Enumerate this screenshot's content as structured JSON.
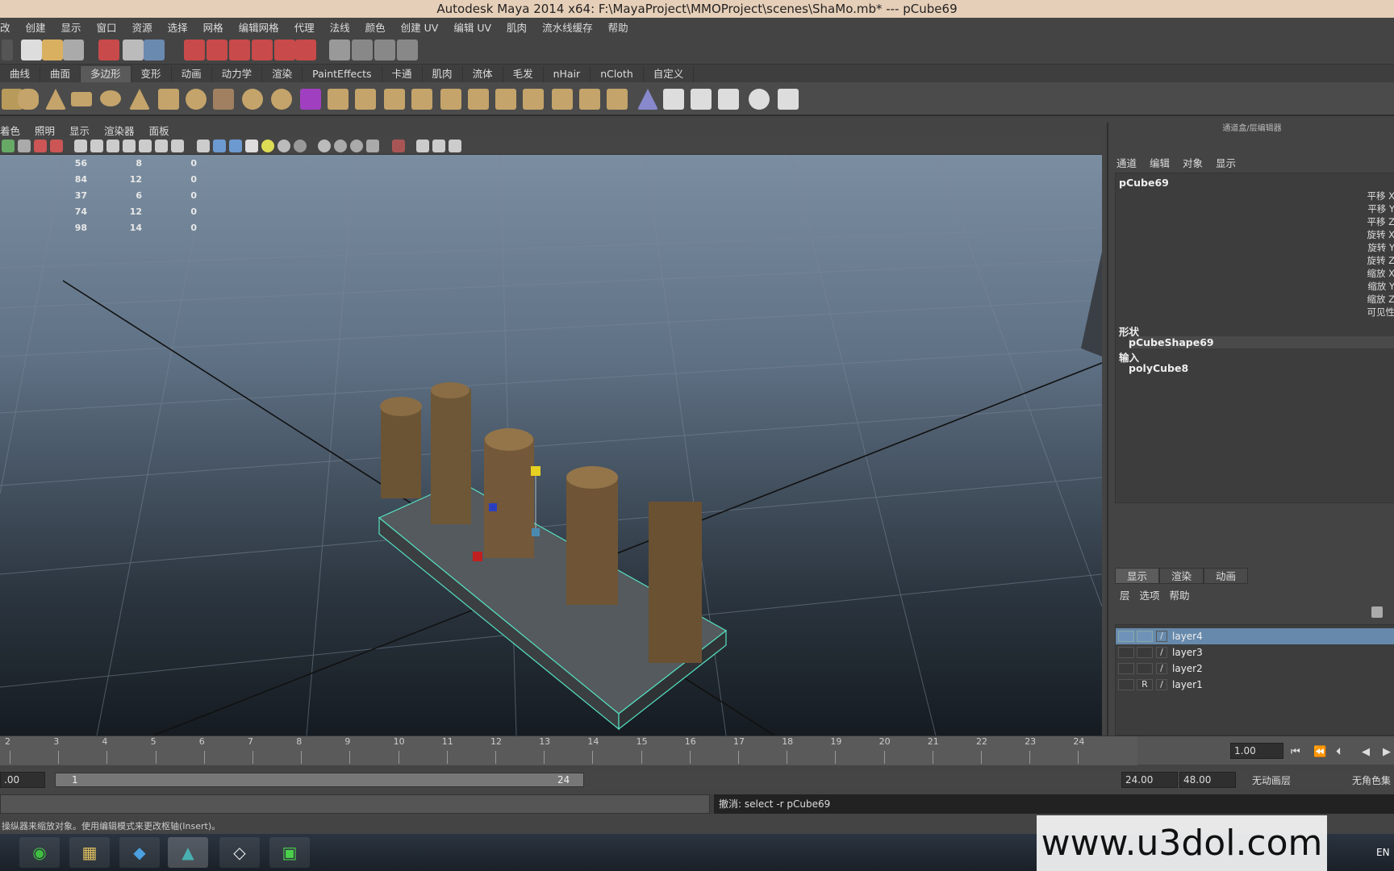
{
  "window": {
    "title": "Autodesk Maya 2014 x64: F:\\MayaProject\\MMOProject\\scenes\\ShaMo.mb*   ---   pCube69"
  },
  "menubar": [
    "改",
    "创建",
    "显示",
    "窗口",
    "资源",
    "选择",
    "网格",
    "编辑网格",
    "代理",
    "法线",
    "颜色",
    "创建 UV",
    "编辑 UV",
    "肌肉",
    "流水线缓存",
    "帮助"
  ],
  "shelf_tabs": [
    {
      "label": "曲线",
      "active": false
    },
    {
      "label": "曲面",
      "active": false
    },
    {
      "label": "多边形",
      "active": true
    },
    {
      "label": "变形",
      "active": false
    },
    {
      "label": "动画",
      "active": false
    },
    {
      "label": "动力学",
      "active": false
    },
    {
      "label": "渲染",
      "active": false
    },
    {
      "label": "PaintEffects",
      "active": false
    },
    {
      "label": "卡通",
      "active": false
    },
    {
      "label": "肌肉",
      "active": false
    },
    {
      "label": "流体",
      "active": false
    },
    {
      "label": "毛发",
      "active": false
    },
    {
      "label": "nHair",
      "active": false
    },
    {
      "label": "nCloth",
      "active": false
    },
    {
      "label": "自定义",
      "active": false
    }
  ],
  "panel_menu": [
    "着色",
    "照明",
    "显示",
    "渲染器",
    "面板"
  ],
  "hud": [
    [
      "56",
      "8",
      "0"
    ],
    [
      "84",
      "12",
      "0"
    ],
    [
      "37",
      "6",
      "0"
    ],
    [
      "74",
      "12",
      "0"
    ],
    [
      "98",
      "14",
      "0"
    ]
  ],
  "channel_box": {
    "title": "通道盒/层编辑器",
    "menu": [
      "通道",
      "编辑",
      "对象",
      "显示"
    ],
    "object": "pCube69",
    "attributes": [
      "平移 X",
      "平移 Y",
      "平移 Z",
      "旋转 X",
      "旋转 Y",
      "旋转 Z",
      "缩放 X",
      "缩放 Y",
      "缩放 Z",
      "可见性"
    ],
    "shapes_label": "形状",
    "shape": "pCubeShape69",
    "inputs_label": "输入",
    "input": "polyCube8"
  },
  "layer_editor": {
    "tabs": [
      {
        "label": "显示",
        "active": true
      },
      {
        "label": "渲染",
        "active": false
      },
      {
        "label": "动画",
        "active": false
      }
    ],
    "menu": [
      "层",
      "选项",
      "帮助"
    ],
    "layers": [
      {
        "name": "layer4",
        "selected": true,
        "flag": ""
      },
      {
        "name": "layer3",
        "selected": false,
        "flag": ""
      },
      {
        "name": "layer2",
        "selected": false,
        "flag": ""
      },
      {
        "name": "layer1",
        "selected": false,
        "flag": "R"
      }
    ]
  },
  "timeline": {
    "ticks": [
      "2",
      "3",
      "4",
      "5",
      "6",
      "7",
      "8",
      "9",
      "10",
      "11",
      "12",
      "13",
      "14",
      "15",
      "16",
      "17",
      "18",
      "19",
      "20",
      "21",
      "22",
      "23",
      "24"
    ],
    "current_frame": "1.00"
  },
  "range": {
    "start_field": ".00",
    "range_start": "1",
    "range_end": "24",
    "end_field": "24.00",
    "end_total": "48.00",
    "anim_layer": "无动画层",
    "char_set": "无角色集"
  },
  "command": {
    "result": "撤消: select -r pCube69"
  },
  "helpline": "操纵器来缩放对象。使用编辑模式来更改枢轴(Insert)。",
  "watermark": "www.u3dol.com",
  "taskbar": {
    "lang": "EN"
  }
}
